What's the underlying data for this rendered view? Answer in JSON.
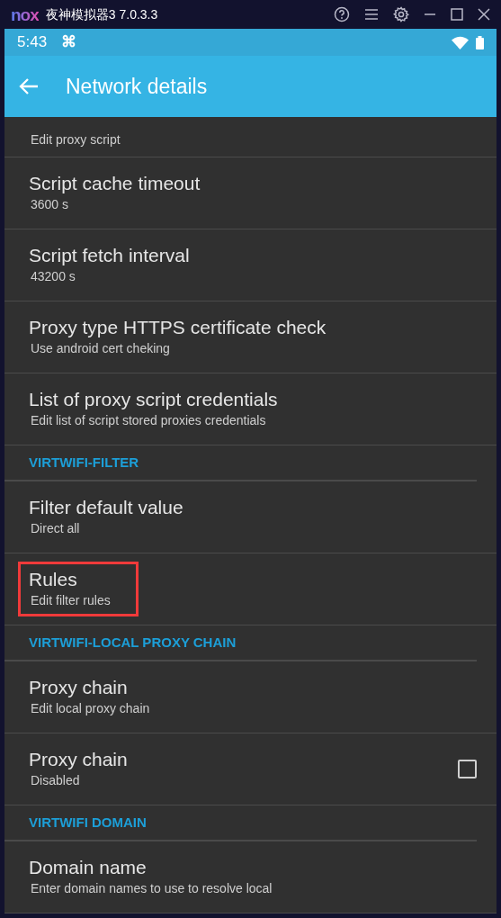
{
  "window": {
    "logo": "nox",
    "title": "夜神模拟器3 7.0.3.3"
  },
  "status_bar": {
    "time": "5:43",
    "notification_icon": "⌘"
  },
  "app_bar": {
    "title": "Network details"
  },
  "items": [
    {
      "kind": "pref",
      "summary": "Edit proxy script",
      "highlighted": false
    },
    {
      "kind": "pref",
      "title": "Script cache timeout",
      "summary": "3600 s",
      "highlighted": false
    },
    {
      "kind": "pref",
      "title": "Script fetch interval",
      "summary": "43200 s",
      "highlighted": false
    },
    {
      "kind": "pref",
      "title": "Proxy type HTTPS certificate check",
      "summary": "Use android cert cheking",
      "highlighted": false
    },
    {
      "kind": "pref",
      "title": "List of proxy script credentials",
      "summary": "Edit list of script stored proxies credentials",
      "highlighted": false
    },
    {
      "kind": "header",
      "title": "VIRTWIFI-FILTER"
    },
    {
      "kind": "pref",
      "title": "Filter default value",
      "summary": "Direct all",
      "highlighted": false
    },
    {
      "kind": "pref",
      "title": "Rules",
      "summary": "Edit filter rules",
      "highlighted": true
    },
    {
      "kind": "header",
      "title": "VIRTWIFI-LOCAL PROXY CHAIN"
    },
    {
      "kind": "pref",
      "title": "Proxy chain",
      "summary": "Edit local proxy chain",
      "highlighted": false
    },
    {
      "kind": "check",
      "title": "Proxy chain",
      "summary": "Disabled",
      "checked": false
    },
    {
      "kind": "header",
      "title": "VIRTWIFI DOMAIN"
    },
    {
      "kind": "pref",
      "title": "Domain name",
      "summary": "Enter domain names to use to resolve local",
      "highlighted": false
    }
  ]
}
